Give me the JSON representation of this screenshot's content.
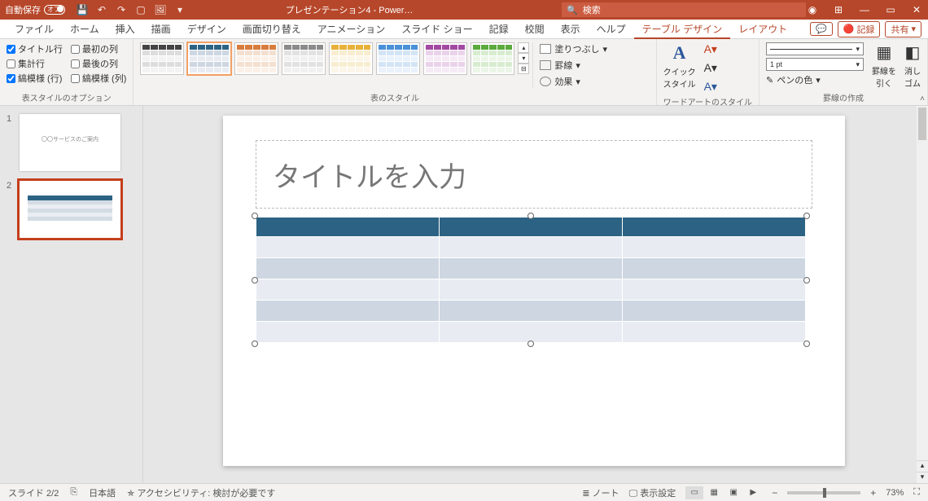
{
  "titlebar": {
    "autosave_label": "自動保存",
    "autosave_state": "オフ",
    "doc_title": "プレゼンテーション4 - Power…",
    "search_placeholder": "検索"
  },
  "tabs": {
    "file": "ファイル",
    "home": "ホーム",
    "insert": "挿入",
    "draw": "描画",
    "design": "デザイン",
    "transitions": "画面切り替え",
    "animations": "アニメーション",
    "slideshow": "スライド ショー",
    "record": "記録",
    "review": "校閲",
    "view": "表示",
    "help": "ヘルプ",
    "table_design": "テーブル デザイン",
    "layout": "レイアウト",
    "rec_btn": "記録",
    "share_btn": "共有"
  },
  "ribbon": {
    "opts_group": "表スタイルのオプション",
    "header_row": "タイトル行",
    "first_col": "最初の列",
    "total_row": "集計行",
    "last_col": "最後の列",
    "banded_rows": "縞模様 (行)",
    "banded_cols": "縞模様 (列)",
    "styles_group": "表のスタイル",
    "shading": "塗りつぶし",
    "borders": "罫線",
    "effects": "効果",
    "wordart_group": "ワードアートのスタイル",
    "quick_styles": "クイック\nスタイル",
    "draw_group": "罫線の作成",
    "pen_weight": "1 pt",
    "pen_color": "ペンの色",
    "draw_table": "罫線を\n引く",
    "eraser": "消し\nゴム"
  },
  "slide": {
    "title_placeholder": "タイトルを入力",
    "thumb1_text": "〇〇サービスのご案内"
  },
  "status": {
    "slide_count": "スライド 2/2",
    "language": "日本語",
    "accessibility": "アクセシビリティ: 検討が必要です",
    "notes": "ノート",
    "display_settings": "表示設定",
    "zoom": "73%"
  },
  "thumbs": {
    "n1": "1",
    "n2": "2"
  }
}
